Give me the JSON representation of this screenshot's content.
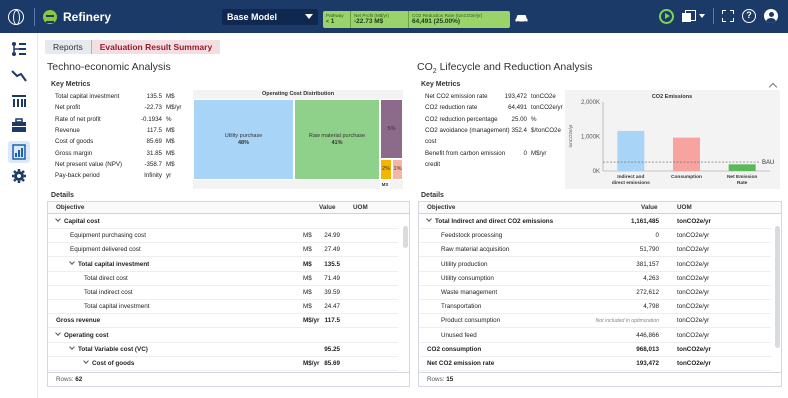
{
  "header": {
    "app_title": "Refinery",
    "model_select": "Base Model",
    "kpis": [
      {
        "label": "Pathway",
        "value": "1"
      },
      {
        "label": "Net Profit (M$/yr)",
        "value": "-22.73 M$"
      },
      {
        "label": "CO2 Reduction Rate (tonCO2e/yr)",
        "value": "64,491 (25.00%)"
      }
    ],
    "help": "?"
  },
  "breadcrumb": [
    "Reports",
    "Evaluation Result Summary"
  ],
  "left": {
    "title": "Techno-economic Analysis",
    "key_metrics_title": "Key Metrics",
    "metrics": [
      {
        "label": "Total capital investment",
        "value": "135.5",
        "unit": "M$"
      },
      {
        "label": "Net profit",
        "value": "-22.73",
        "unit": "M$/yr"
      },
      {
        "label": "Rate of net profit",
        "value": "-0.1934",
        "unit": "%"
      },
      {
        "label": "Revenue",
        "value": "117.5",
        "unit": "M$"
      },
      {
        "label": "Cost of goods",
        "value": "85.69",
        "unit": "M$"
      },
      {
        "label": "Gross margin",
        "value": "31.85",
        "unit": "M$"
      },
      {
        "label": "Net present value (NPV)",
        "value": "-358.7",
        "unit": "M$"
      },
      {
        "label": "Pay-back period",
        "value": "Infinity",
        "unit": "yr"
      }
    ],
    "treemap": {
      "title": "Operating Cost Distribution",
      "cells": [
        {
          "label": "Utility purchase",
          "pct": "48%",
          "share": 0.48,
          "color": "#a8d4f7"
        },
        {
          "label": "Raw material purchase",
          "pct": "41%",
          "share": 0.41,
          "color": "#8fd18b"
        },
        {
          "label": "5%",
          "pct": "",
          "share": 0.05,
          "color": "#8b6a8a"
        },
        {
          "label": "2%",
          "pct": "",
          "share": 0.02,
          "color": "#f5b400"
        },
        {
          "label": "1%",
          "pct": "",
          "share": 0.01,
          "color": "#f5b7a5"
        },
        {
          "label": "MS",
          "pct": "",
          "share": 0.005,
          "color": "#333333"
        }
      ]
    },
    "details_title": "Details",
    "table": {
      "headers": [
        "Objective",
        "Value",
        "UOM"
      ],
      "rows": [
        {
          "label": "Capital cost",
          "value": "",
          "uom": "",
          "level": 0,
          "bold": true,
          "chev": true
        },
        {
          "label": "Equipment purchasing cost",
          "value": "24.99",
          "uom": "M$",
          "level": 1,
          "bold": false,
          "chev": false
        },
        {
          "label": "Equipment delivered cost",
          "value": "27.49",
          "uom": "M$",
          "level": 1,
          "bold": false,
          "chev": false
        },
        {
          "label": "Total capital investment",
          "value": "135.5",
          "uom": "M$",
          "level": 1,
          "bold": true,
          "chev": true
        },
        {
          "label": "Total direct cost",
          "value": "71.49",
          "uom": "M$",
          "level": 2,
          "bold": false,
          "chev": false
        },
        {
          "label": "Total indirect cost",
          "value": "39.59",
          "uom": "M$",
          "level": 2,
          "bold": false,
          "chev": false
        },
        {
          "label": "Total capital investment",
          "value": "24.47",
          "uom": "M$",
          "level": 2,
          "bold": false,
          "chev": false
        },
        {
          "label": "Gross revenue",
          "value": "117.5",
          "uom": "M$/yr",
          "level": 0,
          "bold": true,
          "chev": false
        },
        {
          "label": "Operating cost",
          "value": "",
          "uom": "",
          "level": 0,
          "bold": true,
          "chev": true
        },
        {
          "label": "Total Variable cost (VC)",
          "value": "95.25",
          "uom": "",
          "level": 1,
          "bold": true,
          "chev": true
        },
        {
          "label": "Cost of goods",
          "value": "85.69",
          "uom": "M$/yr",
          "level": 2,
          "bold": true,
          "chev": true
        }
      ],
      "rows_label": "Rows:",
      "rows_count": "62"
    }
  },
  "right": {
    "title_prefix": "CO",
    "title_sub": "2",
    "title_suffix": " Lifecycle and Reduction Analysis",
    "key_metrics_title": "Key Metrics",
    "metrics": [
      {
        "label": "Net CO2 emission rate",
        "value": "193,472",
        "unit": "tonCO2e"
      },
      {
        "label": "CO2 reduction rate",
        "value": "64,491",
        "unit": "tonCO2e/yr"
      },
      {
        "label": "CO2 reduction percentage",
        "value": "25.00",
        "unit": "%"
      },
      {
        "label": "CO2 avoidance (management)",
        "value": "352.4",
        "unit": "$/tonCO2e"
      },
      {
        "label": "cost",
        "value": "",
        "unit": ""
      },
      {
        "label": "Benefit from carbon emission",
        "value": "0",
        "unit": "M$/yr"
      },
      {
        "label": "credit",
        "value": "",
        "unit": ""
      }
    ],
    "details_title": "Details",
    "table": {
      "headers": [
        "Objective",
        "Value",
        "UOM"
      ],
      "rows": [
        {
          "label": "Total Indirect and direct CO2 emissions",
          "value": "1,161,485",
          "uom": "tonCO2e/yr",
          "level": 0,
          "bold": true,
          "chev": true,
          "note": ""
        },
        {
          "label": "Feedstock processing",
          "value": "0",
          "uom": "tonCO2e/yr",
          "level": 1,
          "bold": false,
          "chev": false,
          "note": ""
        },
        {
          "label": "Raw material acquisition",
          "value": "51,790",
          "uom": "tonCO2e/yr",
          "level": 1,
          "bold": false,
          "chev": false,
          "note": ""
        },
        {
          "label": "Utility production",
          "value": "381,157",
          "uom": "tonCO2e/yr",
          "level": 1,
          "bold": false,
          "chev": false,
          "note": ""
        },
        {
          "label": "Utility consumption",
          "value": "4,263",
          "uom": "tonCO2e/yr",
          "level": 1,
          "bold": false,
          "chev": false,
          "note": ""
        },
        {
          "label": "Waste management",
          "value": "272,612",
          "uom": "tonCO2e/yr",
          "level": 1,
          "bold": false,
          "chev": false,
          "note": ""
        },
        {
          "label": "Transportation",
          "value": "4,798",
          "uom": "tonCO2e/yr",
          "level": 1,
          "bold": false,
          "chev": false,
          "note": ""
        },
        {
          "label": "Product consumption",
          "value": "",
          "uom": "tonCO2e/yr",
          "level": 1,
          "bold": false,
          "chev": false,
          "note": "Not included in optimization"
        },
        {
          "label": "Unused feed",
          "value": "446,866",
          "uom": "tonCO2e/yr",
          "level": 1,
          "bold": false,
          "chev": false,
          "note": ""
        },
        {
          "label": "CO2 consumption",
          "value": "968,013",
          "uom": "tonCO2e/yr",
          "level": 0,
          "bold": true,
          "chev": false,
          "note": ""
        },
        {
          "label": "Net CO2 emission rate",
          "value": "193,472",
          "uom": "tonCO2e/yr",
          "level": 0,
          "bold": true,
          "chev": false,
          "note": ""
        }
      ],
      "rows_label": "Rows:",
      "rows_count": "15"
    }
  },
  "chart_data": {
    "type": "bar",
    "title": "CO2 Emissions",
    "ylabel": "tonCO2e/yr",
    "categories": [
      "Indirect and direct emissions",
      "Consumption",
      "Net Emission Rate"
    ],
    "values": [
      1161485,
      968013,
      193472
    ],
    "colors": [
      "#a8d4f7",
      "#f7a3a0",
      "#5cb85c"
    ],
    "yticks": [
      "0K",
      "1,000K",
      "2,000K"
    ],
    "ylim": [
      0,
      2000000
    ],
    "reference": {
      "label": "BAU",
      "value": 257963
    },
    "grid": false
  }
}
